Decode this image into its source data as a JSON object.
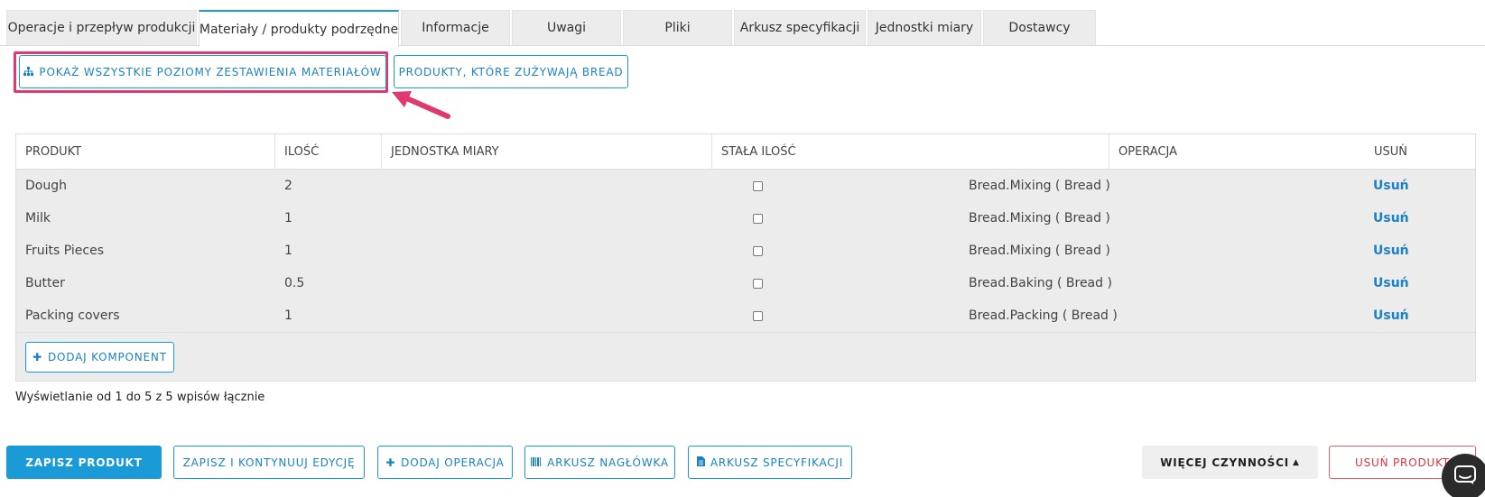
{
  "tabs": [
    {
      "label": "Operacje i przepływ produkcji",
      "active": false
    },
    {
      "label": "Materiały / produkty podrzędne",
      "active": true
    },
    {
      "label": "Informacje",
      "active": false
    },
    {
      "label": "Uwagi",
      "active": false
    },
    {
      "label": "Pliki",
      "active": false
    },
    {
      "label": "Arkusz specyfikacji",
      "active": false
    },
    {
      "label": "Jednostki miary",
      "active": false
    },
    {
      "label": "Dostawcy",
      "active": false
    }
  ],
  "actions": {
    "show_all_levels": "POKAŻ WSZYSTKIE POZIOMY ZESTAWIENIA MATERIAŁÓW",
    "products_using": "PRODUKTY, KTÓRE ZUŻYWAJĄ BREAD"
  },
  "table": {
    "headers": [
      "PRODUKT",
      "ILOŚĆ",
      "JEDNOSTKA MIARY",
      "STAŁA ILOŚĆ",
      "OPERACJA",
      "USUŃ"
    ],
    "rows": [
      {
        "product": "Dough",
        "qty": "2",
        "unit": "",
        "fixed": false,
        "operation": "Bread.Mixing ( Bread )",
        "remove": "Usuń"
      },
      {
        "product": "Milk",
        "qty": "1",
        "unit": "",
        "fixed": false,
        "operation": "Bread.Mixing ( Bread )",
        "remove": "Usuń"
      },
      {
        "product": "Fruits Pieces",
        "qty": "1",
        "unit": "",
        "fixed": false,
        "operation": "Bread.Mixing ( Bread )",
        "remove": "Usuń"
      },
      {
        "product": "Butter",
        "qty": "0.5",
        "unit": "",
        "fixed": false,
        "operation": "Bread.Baking ( Bread )",
        "remove": "Usuń"
      },
      {
        "product": "Packing covers",
        "qty": "1",
        "unit": "",
        "fixed": false,
        "operation": "Bread.Packing ( Bread )",
        "remove": "Usuń"
      }
    ],
    "add_component": "DODAJ KOMPONENT"
  },
  "footer": {
    "records_info": "Wyświetlanie od 1 do 5 z 5 wpisów łącznie"
  },
  "bottom": {
    "save": "ZAPISZ PRODUKT",
    "save_continue": "ZAPISZ I KONTYNUUJ EDYCJĘ",
    "add_operation": "DODAJ OPERACJA",
    "header_sheet": "ARKUSZ NAGŁÓWKA",
    "spec_sheet": "ARKUSZ SPECYFIKACJI",
    "more_actions": "WIĘCEJ CZYNNOŚCI",
    "delete_product": "USUŃ PRODUKT"
  },
  "colors": {
    "accent": "#1a9bd7",
    "highlight": "#e0396f",
    "danger": "#d9363e"
  }
}
